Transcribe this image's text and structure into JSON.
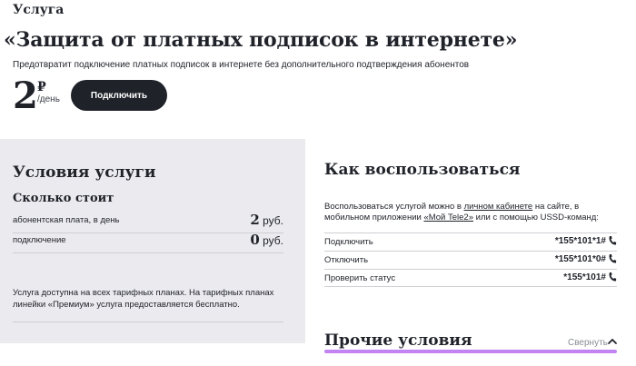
{
  "header": {
    "breadcrumb": "Услуга",
    "title": "«Защита от платных подписок в интернете»",
    "description": "Предотвратит подключение платных подписок в интернете без дополнительного подтверждения абонентов"
  },
  "price": {
    "amount": "2",
    "currency": "₽",
    "unit": "/день",
    "connect_label": "Подключить"
  },
  "conditions": {
    "title": "Условия услуги",
    "cost_heading": "Сколько стоит",
    "rows": [
      {
        "label": "абонентская плата, в день",
        "value": "2",
        "unit": "руб."
      },
      {
        "label": "подключение",
        "value": "0",
        "unit": "руб."
      }
    ],
    "note": "Услуга доступна на всех тарифных планах. На тарифных планах линейки «Премиум» услуга предоставляется бесплатно."
  },
  "howto": {
    "title": "Как воспользоваться",
    "desc_part1": "Воспользоваться услугой можно в ",
    "link_cabinet": "личном кабинете",
    "desc_part2": " на сайте, в мобильном приложении ",
    "link_app": "«Мой Tele2»",
    "desc_part3": " или с помощью USSD-команд:",
    "commands": [
      {
        "label": "Подключить",
        "code": "*155*101*1#"
      },
      {
        "label": "Отключить",
        "code": "*155*101*0#"
      },
      {
        "label": "Проверить статус",
        "code": "*155*101#"
      }
    ]
  },
  "other": {
    "title": "Прочие условия",
    "collapse_label": "Свернуть",
    "accent_color": "#c283f3"
  }
}
